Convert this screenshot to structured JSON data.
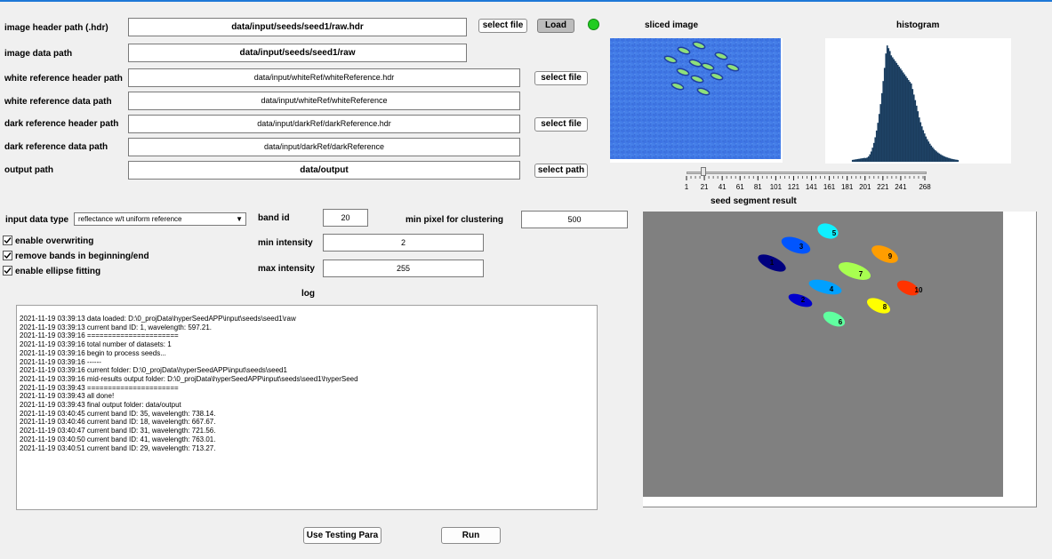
{
  "form": {
    "header_path_label": "image header path (.hdr)",
    "header_path_value": "data/input/seeds/seed1/raw.hdr",
    "data_path_label": "image data path",
    "data_path_value": "data/input/seeds/seed1/raw",
    "white_header_label": "white reference header path",
    "white_header_value": "data/input/whiteRef/whiteReference.hdr",
    "white_data_label": "white reference data path",
    "white_data_value": "data/input/whiteRef/whiteReference",
    "dark_header_label": "dark reference header path",
    "dark_header_value": "data/input/darkRef/darkReference.hdr",
    "dark_data_label": "dark reference data  path",
    "dark_data_value": "data/input/darkRef/darkReference",
    "output_label": "output path",
    "output_value": "data/output"
  },
  "buttons": {
    "select_file": "select file",
    "load": "Load",
    "select_path": "select path",
    "use_testing": "Use Testing Para",
    "run": "Run"
  },
  "status": {
    "indicator_color": "#22cc22"
  },
  "params": {
    "input_type_label": "input data type",
    "input_type_value": "reflectance w/t uniform reference",
    "band_id_label": "band id",
    "band_id_value": "20",
    "min_pixel_label": "min pixel for clustering",
    "min_pixel_value": "500",
    "min_intensity_label": "min intensity",
    "min_intensity_value": "2",
    "max_intensity_label": "max intensity",
    "max_intensity_value": "255"
  },
  "checkboxes": [
    {
      "label": "enable overwriting",
      "checked": true
    },
    {
      "label": "remove bands in beginning/end",
      "checked": true
    },
    {
      "label": "enable ellipse fitting",
      "checked": true
    }
  ],
  "panels": {
    "sliced_title": "sliced image",
    "histogram_title": "histogram",
    "seed_title": "seed segment result"
  },
  "slider": {
    "ticks": [
      "1",
      "21",
      "41",
      "61",
      "81",
      "101",
      "121",
      "141",
      "161",
      "181",
      "201",
      "221",
      "241",
      "268"
    ],
    "value": 20
  },
  "seeds": [
    "1",
    "2",
    "3",
    "4",
    "5",
    "6",
    "7",
    "8",
    "9",
    "10"
  ],
  "log": {
    "title": "log",
    "lines": [
      "2021-11-19 03:39:13 data loaded: D:\\0_projData\\hyperSeedAPP\\input\\seeds\\seed1\\raw",
      "2021-11-19 03:39:13 current band ID: 1, wavelength: 597.21.",
      "2021-11-19 03:39:16 ======================",
      "2021-11-19 03:39:16 total number of datasets: 1",
      "2021-11-19 03:39:16 begin to process seeds...",
      "2021-11-19 03:39:16 ------",
      "2021-11-19 03:39:16 current folder: D:\\0_projData\\hyperSeedAPP\\input\\seeds\\seed1",
      "2021-11-19 03:39:16 mid-results output folder: D:\\0_projData\\hyperSeedAPP\\input\\seeds\\seed1\\hyperSeed",
      "2021-11-19 03:39:43 ======================",
      "2021-11-19 03:39:43 all done!",
      "2021-11-19 03:39:43 final output folder: data/output",
      "2021-11-19 03:40:45 current band ID: 35, wavelength: 738.14.",
      "2021-11-19 03:40:46 current band ID: 18, wavelength: 667.67.",
      "2021-11-19 03:40:47 current band ID: 31, wavelength: 721.56.",
      "2021-11-19 03:40:50 current band ID: 41, wavelength: 763.01.",
      "2021-11-19 03:40:51 current band ID: 29, wavelength: 713.27."
    ]
  }
}
